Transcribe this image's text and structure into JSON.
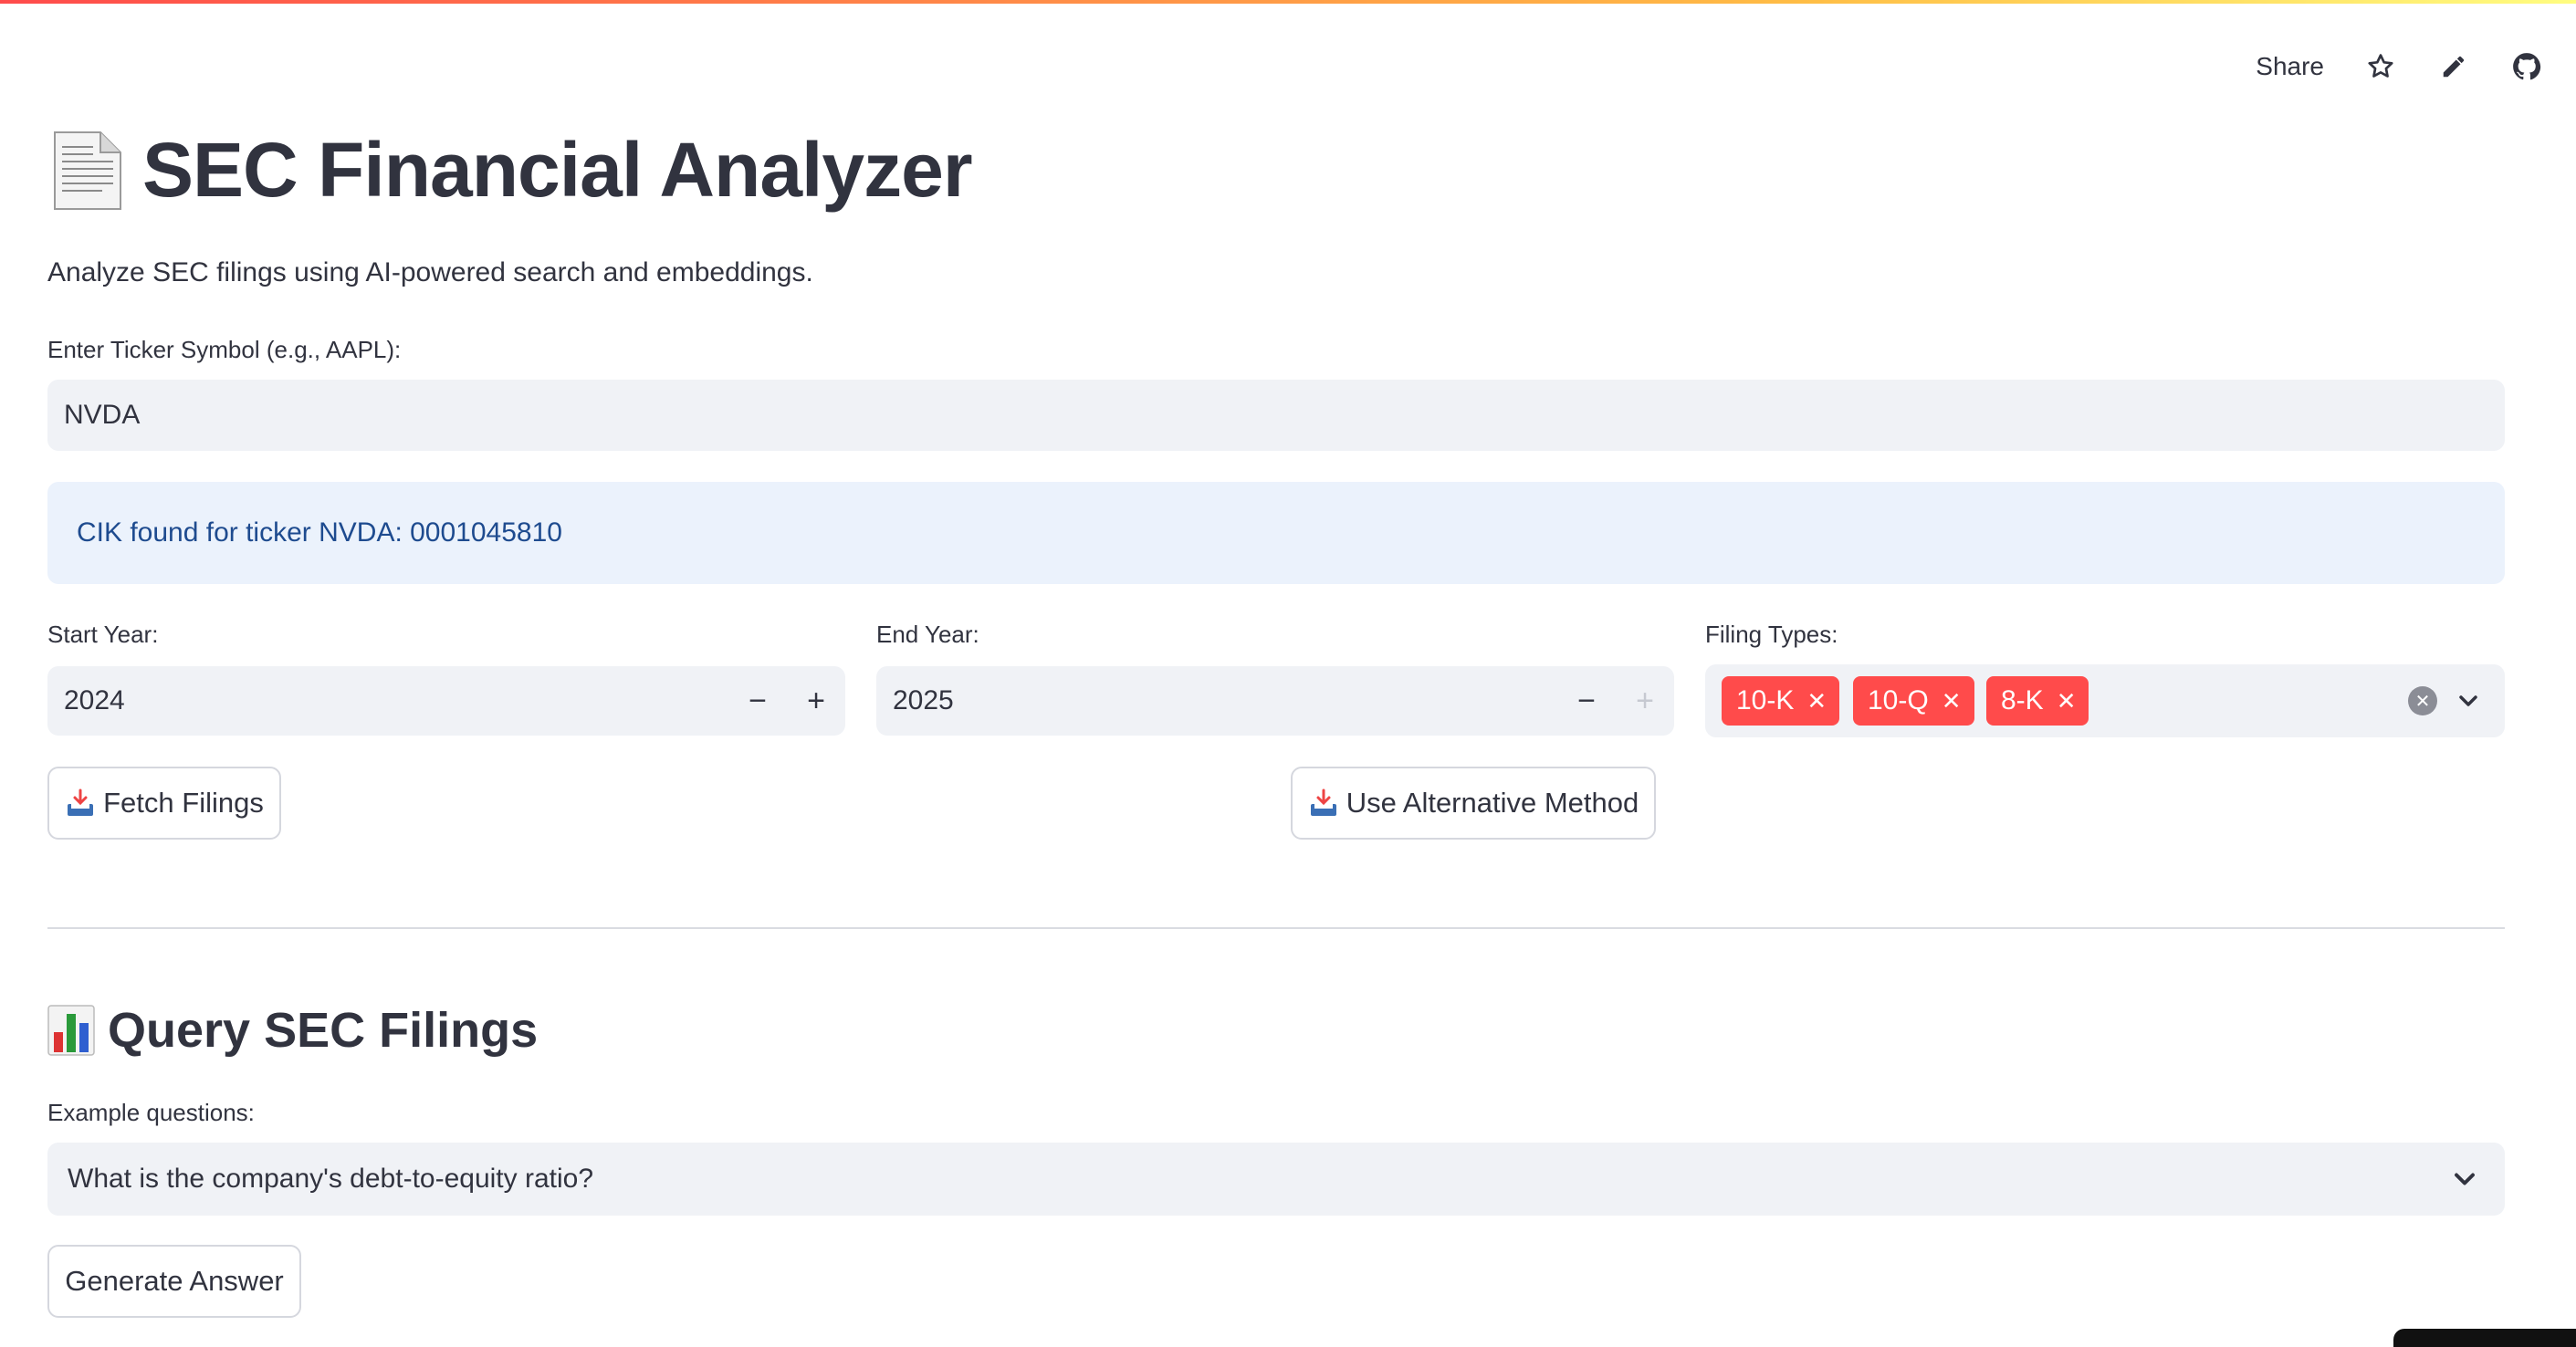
{
  "toolbar": {
    "share_label": "Share",
    "icons": [
      "star-icon",
      "pencil-icon",
      "github-icon"
    ]
  },
  "header": {
    "title": "SEC Financial Analyzer",
    "subtitle": "Analyze SEC filings using AI-powered search and embeddings."
  },
  "ticker": {
    "label": "Enter Ticker Symbol (e.g., AAPL):",
    "value": "NVDA"
  },
  "info_message": "CIK found for ticker NVDA: 0001045810",
  "start_year": {
    "label": "Start Year:",
    "value": "2024",
    "minus": "−",
    "plus": "+"
  },
  "end_year": {
    "label": "End Year:",
    "value": "2025",
    "minus": "−",
    "plus": "+"
  },
  "filing_types": {
    "label": "Filing Types:",
    "selected": [
      "10-K",
      "10-Q",
      "8-K"
    ],
    "chip_color": "#ff4b4b"
  },
  "buttons": {
    "fetch": "Fetch Filings",
    "alternative": "Use Alternative Method",
    "generate": "Generate Answer"
  },
  "query_section": {
    "title": "Query SEC Filings",
    "example_label": "Example questions:",
    "selected_question": "What is the company's debt-to-equity ratio?"
  },
  "colors": {
    "accent": "#ff4b4b",
    "info_bg": "#ebf2fc",
    "info_text": "#1e4b8f",
    "input_bg": "#f0f2f6"
  }
}
